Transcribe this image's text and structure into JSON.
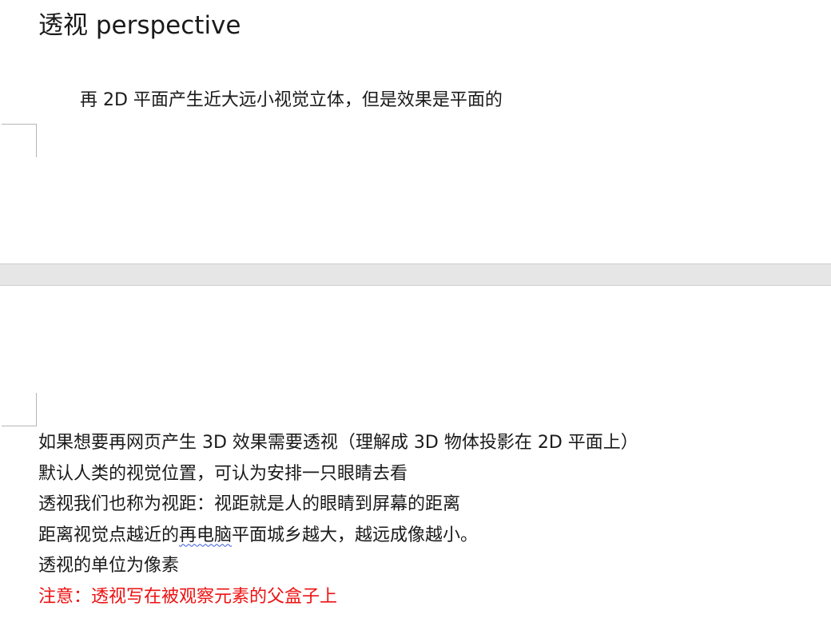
{
  "heading": "透视 perspective",
  "intro": "再 2D 平面产生近大远小视觉立体，但是效果是平面的",
  "lines": [
    "如果想要再网页产生 3D 效果需要透视（理解成 3D 物体投影在 2D 平面上）",
    "默认人类的视觉位置，可认为安排一只眼睛去看",
    "透视我们也称为视距：视距就是人的眼睛到屏幕的距离"
  ],
  "line4": {
    "before": "距离视觉点越近的",
    "underlined": "再电脑",
    "after": "平面城乡越大，越远成像越小。"
  },
  "line5": "透视的单位为像素",
  "note": "注意：透视写在被观察元素的父盒子上",
  "colors": {
    "text": "#1a1a1a",
    "note": "#ee1111",
    "spellcheck": "#3a5bd6",
    "page_gap": "#e6e6e6"
  }
}
